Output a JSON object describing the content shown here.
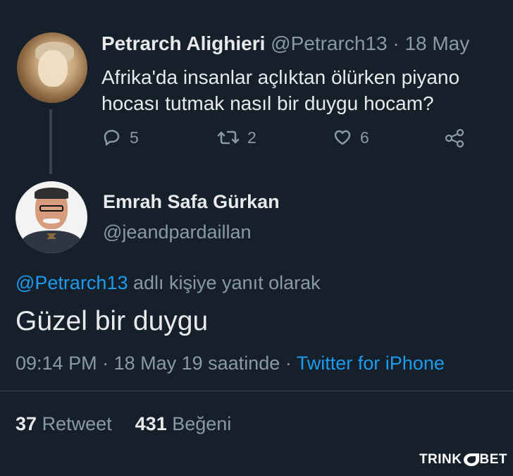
{
  "parent_tweet": {
    "author_name": "Petrarch Alighieri",
    "author_handle": "@Petrarch13",
    "separator": "·",
    "date": "18 May",
    "text": "Afrika'da insanlar açlıktan ölürken piyano hocası tutmak nasıl bir duygu hocam?",
    "actions": {
      "reply_count": "5",
      "retweet_count": "2",
      "like_count": "6"
    },
    "icons": {
      "reply": "reply-icon",
      "retweet": "retweet-icon",
      "like": "heart-icon",
      "share": "share-icon"
    }
  },
  "reply_tweet": {
    "author_name": "Emrah Safa Gürkan",
    "author_handle": "@jeandpardaillan",
    "reply_context_mention": "@Petrarch13",
    "reply_context_suffix": " adlı kişiye yanıt olarak",
    "text": "Güzel bir duygu",
    "time": "09:14 PM",
    "separator_1": " · ",
    "date_text": "18 May 19 saatinde",
    "separator_2": " · ",
    "source": "Twitter for iPhone",
    "retweets_count": "37",
    "retweets_label": "Retweet",
    "likes_count": "431",
    "likes_label": "Beğeni"
  },
  "watermark": {
    "prefix": "TRINK",
    "suffix": "BET"
  },
  "colors": {
    "background": "#15202b",
    "text": "#e7e9ea",
    "muted": "#8b98a5",
    "accent": "#1d9bf0",
    "divider": "#38444d"
  }
}
